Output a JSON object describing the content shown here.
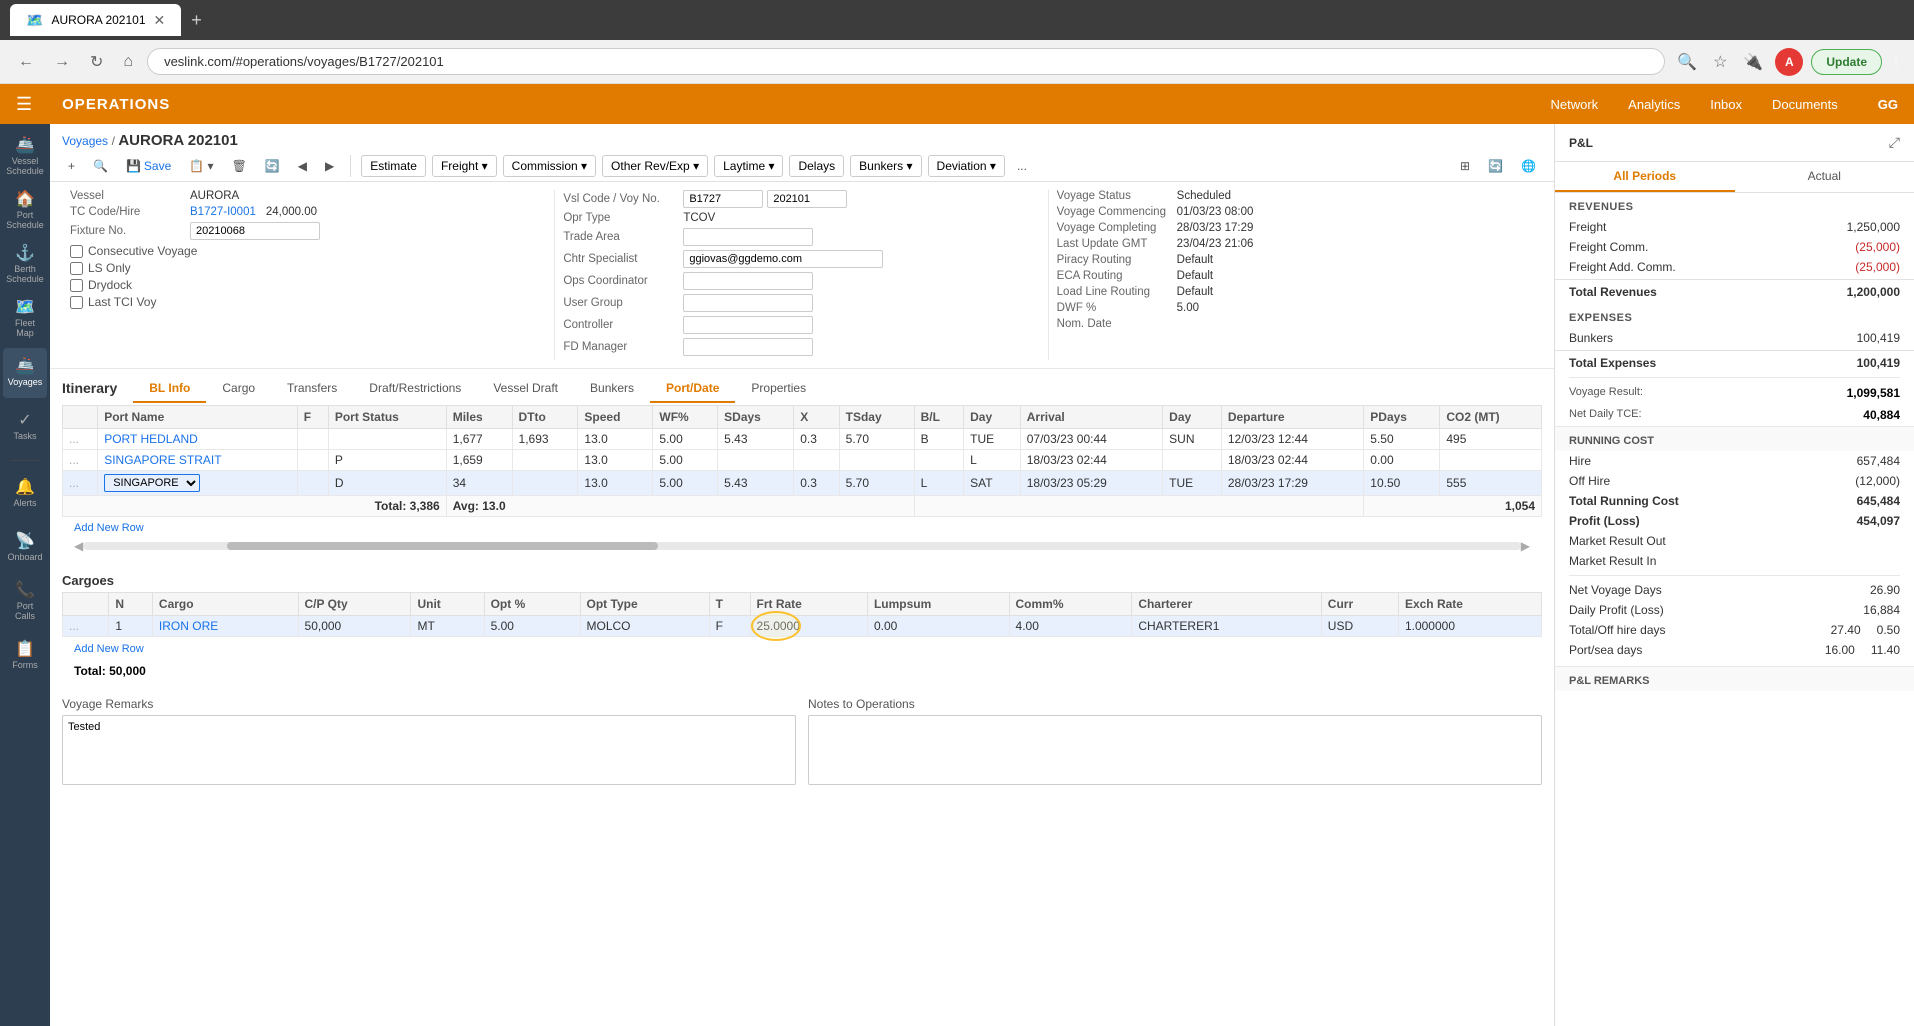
{
  "browser": {
    "tab_title": "AURORA 202101",
    "url": "veslink.com/#operations/voyages/B1727/202101",
    "update_btn": "Update"
  },
  "topnav": {
    "title": "OPERATIONS",
    "links": [
      "Network",
      "Analytics",
      "Inbox",
      "Documents"
    ],
    "user_initials": "GG"
  },
  "sidebar": {
    "items": [
      {
        "icon": "🚢",
        "label": "Vessel\nSchedule"
      },
      {
        "icon": "🏠",
        "label": "Port\nSchedule"
      },
      {
        "icon": "📋",
        "label": "Berth\nSchedule"
      },
      {
        "icon": "🗺️",
        "label": "Fleet\nMap"
      },
      {
        "icon": "🚢",
        "label": "Voyages"
      },
      {
        "icon": "✓",
        "label": "Tasks"
      },
      {
        "icon": "🔔",
        "label": "Alerts"
      },
      {
        "icon": "🏠",
        "label": "Onboard"
      },
      {
        "icon": "📞",
        "label": "Port\nCalls"
      },
      {
        "icon": "📋",
        "label": "Forms"
      }
    ]
  },
  "breadcrumb": {
    "parent": "Voyages",
    "current": "AURORA 202101"
  },
  "toolbar": {
    "add_label": "+",
    "search_label": "🔍",
    "save_label": "💾 Save",
    "copy_label": "📋",
    "delete_label": "🗑",
    "refresh_label": "🔄",
    "prev_label": "◀",
    "next_label": "▶",
    "estimate_label": "Estimate",
    "freight_label": "Freight ▾",
    "commission_label": "Commission ▾",
    "other_rev_label": "Other Rev/Exp ▾",
    "laytime_label": "Laytime ▾",
    "delays_label": "Delays",
    "bunkers_label": "Bunkers ▾",
    "deviation_label": "Deviation ▾",
    "more_label": "..."
  },
  "vessel_info": {
    "vessel_label": "Vessel",
    "vessel_value": "AURORA",
    "tc_code_label": "TC Code/Hire",
    "tc_code_value": "B1727-I0001",
    "tc_hire_value": "24,000.00",
    "fixture_label": "Fixture No.",
    "fixture_value": "20210068",
    "consecutive_voyage": "Consecutive Voyage",
    "ls_only": "LS Only",
    "drydock": "Drydock",
    "last_tci_voy": "Last TCI Voy",
    "vsl_code_label": "Vsl Code / Voy No.",
    "vsl_code_value": "B1727",
    "voy_no_value": "202101",
    "opr_type_label": "Opr Type",
    "opr_type_value": "TCOV",
    "trade_area_label": "Trade Area",
    "chtr_specialist_label": "Chtr Specialist",
    "chtr_specialist_value": "ggiovas@ggdemo.com",
    "ops_coordinator_label": "Ops Coordinator",
    "user_group_label": "User Group",
    "controller_label": "Controller",
    "fd_manager_label": "FD Manager",
    "voyage_status_label": "Voyage Status",
    "voyage_status_value": "Scheduled",
    "voyage_commencing_label": "Voyage Commencing",
    "voyage_commencing_value": "01/03/23 08:00",
    "voyage_completing_label": "Voyage Completing",
    "voyage_completing_value": "28/03/23 17:29",
    "last_update_label": "Last Update GMT",
    "last_update_value": "23/04/23 21:06",
    "piracy_routing_label": "Piracy Routing",
    "piracy_routing_value": "Default",
    "eca_routing_label": "ECA Routing",
    "eca_routing_value": "Default",
    "load_line_label": "Load Line Routing",
    "load_line_value": "Default",
    "dwf_label": "DWF %",
    "dwf_value": "5.00",
    "nom_date_label": "Nom. Date"
  },
  "itinerary": {
    "section_title": "Itinerary",
    "tabs": [
      "BL Info",
      "Cargo",
      "Transfers",
      "Draft/Restrictions",
      "Vessel Draft",
      "Bunkers",
      "Port/Date",
      "Properties"
    ],
    "columns": [
      "Port Name",
      "F",
      "Port Status",
      "Miles",
      "DTto",
      "Speed",
      "WF%",
      "SDays",
      "X",
      "TSday",
      "B/L",
      "Day",
      "Arrival",
      "Day",
      "Departure",
      "PDays",
      "CO2 (MT)"
    ],
    "rows": [
      {
        "handle": "...",
        "port": "PORT HEDLAND",
        "f": "",
        "status": "",
        "miles": "1,677",
        "dто": "1,693",
        "speed": "13.0",
        "wf": "5.00",
        "sdays": "5.43",
        "x": "0.3",
        "tsday": "5.70",
        "bl": "B",
        "day": "TUE",
        "arrival": "07/03/23 00:44",
        "dep_day": "SUN",
        "departure": "12/03/23 12:44",
        "pdays": "5.50",
        "co2": "495"
      },
      {
        "handle": "...",
        "port": "SINGAPORE STRAIT",
        "f": "",
        "status": "P",
        "miles": "1,659",
        "dто": "",
        "speed": "13.0",
        "wf": "5.00",
        "sdays": "",
        "x": "",
        "tsday": "",
        "bl": "",
        "day": "L",
        "arrival": "18/03/23 02:44",
        "dep_day": "",
        "departure": "18/03/23 02:44",
        "pdays": "0.00",
        "co2": ""
      },
      {
        "handle": "...",
        "port": "SINGAPORE",
        "f": "",
        "status": "D",
        "miles": "34",
        "dто": "",
        "speed": "13.0",
        "wf": "5.00",
        "sdays": "5.43",
        "x": "0.3",
        "tsday": "5.70",
        "bl": "L",
        "day": "SAT",
        "arrival": "18/03/23 05:29",
        "dep_day": "TUE",
        "departure": "28/03/23 17:29",
        "pdays": "10.50",
        "co2": "555"
      }
    ],
    "total_miles": "Total: 3,386",
    "avg_speed": "Avg: 13.0",
    "total_co2": "1,054",
    "add_row": "Add New Row"
  },
  "cargoes": {
    "section_title": "Cargoes",
    "columns": [
      "N",
      "Cargo",
      "C/P Qty",
      "Unit",
      "Opt %",
      "Opt Type",
      "T",
      "Frt Rate",
      "Lumpsum",
      "Comm%",
      "Charterer",
      "Curr",
      "Exch Rate"
    ],
    "rows": [
      {
        "n": "1",
        "cargo": "IRON ORE",
        "cp_qty": "50,000",
        "unit": "MT",
        "opt": "5.00",
        "opt_type": "MOLCO",
        "t": "F",
        "frt_rate": "25.0000",
        "lumpsum": "0.00",
        "comm": "4.00",
        "charterer": "CHARTERER1",
        "curr": "USD",
        "exch_rate": "1.000000"
      }
    ],
    "total": "Total: 50,000",
    "add_row": "Add New Row"
  },
  "remarks": {
    "voyage_remarks_label": "Voyage Remarks",
    "voyage_remarks_value": "Tested",
    "notes_to_ops_label": "Notes to Operations",
    "notes_to_ops_value": ""
  },
  "pnl": {
    "title": "P&L",
    "tabs": [
      "All Periods",
      "Actual"
    ],
    "revenues_title": "REVENUES",
    "freight_label": "Freight",
    "freight_value": "1,250,000",
    "freight_comm_label": "Freight Comm.",
    "freight_comm_value": "(25,000)",
    "freight_add_comm_label": "Freight Add. Comm.",
    "freight_add_comm_value": "(25,000)",
    "total_revenues_label": "Total Revenues",
    "total_revenues_value": "1,200,000",
    "expenses_title": "EXPENSES",
    "bunkers_label": "Bunkers",
    "bunkers_value": "100,419",
    "total_expenses_label": "Total Expenses",
    "total_expenses_value": "100,419",
    "voyage_result_label": "Voyage Result:",
    "voyage_result_value": "1,099,581",
    "net_daily_tce_label": "Net Daily TCE:",
    "net_daily_tce_value": "40,884",
    "running_cost_title": "RUNNING COST",
    "hire_label": "Hire",
    "hire_value": "657,484",
    "off_hire_label": "Off Hire",
    "off_hire_value": "(12,000)",
    "total_running_cost_label": "Total Running Cost",
    "total_running_cost_value": "645,484",
    "profit_loss_label": "Profit (Loss)",
    "profit_loss_value": "454,097",
    "market_result_out_label": "Market Result Out",
    "market_result_in_label": "Market Result In",
    "net_voyage_days_label": "Net Voyage Days",
    "net_voyage_days_value": "26.90",
    "daily_profit_label": "Daily Profit (Loss)",
    "daily_profit_value": "16,884",
    "total_off_hire_label": "Total/Off hire days",
    "total_off_hire_1": "27.40",
    "total_off_hire_2": "0.50",
    "port_sea_label": "Port/sea days",
    "port_sea_1": "16.00",
    "port_sea_2": "11.40",
    "pnl_remarks_title": "P&L REMARKS"
  }
}
